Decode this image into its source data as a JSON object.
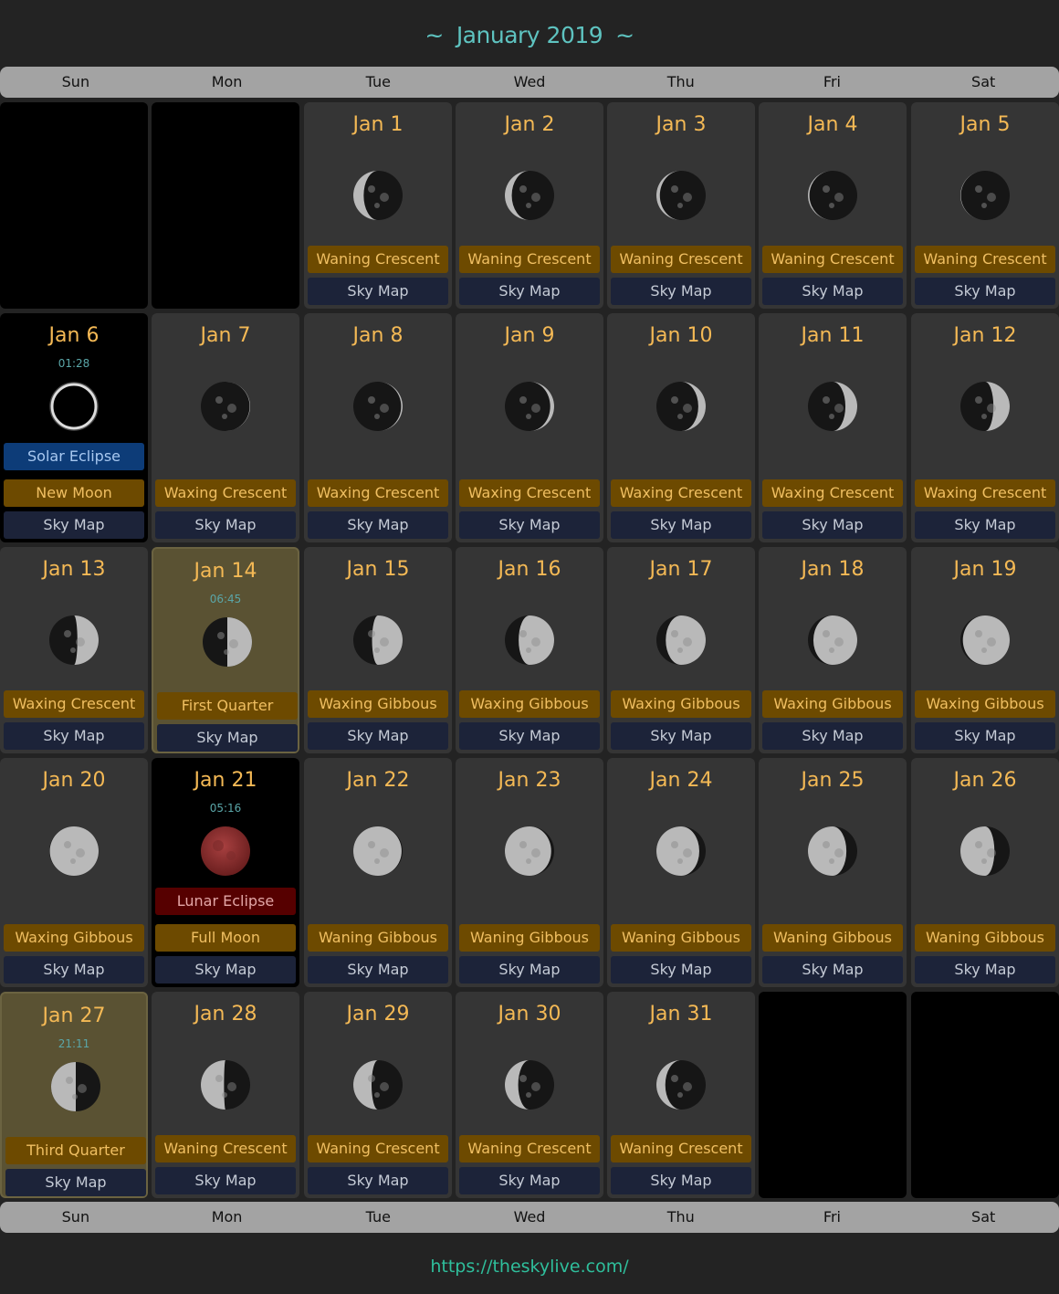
{
  "header": {
    "title": "January 2019",
    "tilde": "~"
  },
  "days_of_week": [
    "Sun",
    "Mon",
    "Tue",
    "Wed",
    "Thu",
    "Fri",
    "Sat"
  ],
  "sky_map_label": "Sky Map",
  "colors": {
    "accent_title": "#5ec3c0",
    "date_text": "#f4b955",
    "phase_badge": "#6d4a00",
    "skymap_badge": "#1c2339",
    "solar_eclipse_badge": "#0d3c78",
    "lunar_eclipse_badge": "#560000",
    "highlight_cell": "#5a5233",
    "footer_link": "#2fbf9c"
  },
  "days": [
    {
      "date": "Jan 1",
      "phase": "Waning Crescent",
      "illum": 0.21,
      "waxing": false
    },
    {
      "date": "Jan 2",
      "phase": "Waning Crescent",
      "illum": 0.14,
      "waxing": false
    },
    {
      "date": "Jan 3",
      "phase": "Waning Crescent",
      "illum": 0.07,
      "waxing": false
    },
    {
      "date": "Jan 4",
      "phase": "Waning Crescent",
      "illum": 0.03,
      "waxing": false
    },
    {
      "date": "Jan 5",
      "phase": "Waning Crescent",
      "illum": 0.01,
      "waxing": false
    },
    {
      "date": "Jan 6",
      "phase": "New Moon",
      "time": "01:28",
      "event": "Solar Eclipse",
      "event_type": "solar",
      "illum": 0,
      "waxing": true
    },
    {
      "date": "Jan 7",
      "phase": "Waxing Crescent",
      "illum": 0.01,
      "waxing": true
    },
    {
      "date": "Jan 8",
      "phase": "Waxing Crescent",
      "illum": 0.03,
      "waxing": true
    },
    {
      "date": "Jan 9",
      "phase": "Waxing Crescent",
      "illum": 0.08,
      "waxing": true
    },
    {
      "date": "Jan 10",
      "phase": "Waxing Crescent",
      "illum": 0.15,
      "waxing": true
    },
    {
      "date": "Jan 11",
      "phase": "Waxing Crescent",
      "illum": 0.24,
      "waxing": true
    },
    {
      "date": "Jan 12",
      "phase": "Waxing Crescent",
      "illum": 0.33,
      "waxing": true
    },
    {
      "date": "Jan 13",
      "phase": "Waxing Crescent",
      "illum": 0.43,
      "waxing": true
    },
    {
      "date": "Jan 14",
      "phase": "First Quarter",
      "time": "06:45",
      "highlight": true,
      "illum": 0.5,
      "waxing": true
    },
    {
      "date": "Jan 15",
      "phase": "Waxing Gibbous",
      "illum": 0.62,
      "waxing": true
    },
    {
      "date": "Jan 16",
      "phase": "Waxing Gibbous",
      "illum": 0.72,
      "waxing": true
    },
    {
      "date": "Jan 17",
      "phase": "Waxing Gibbous",
      "illum": 0.81,
      "waxing": true
    },
    {
      "date": "Jan 18",
      "phase": "Waxing Gibbous",
      "illum": 0.89,
      "waxing": true
    },
    {
      "date": "Jan 19",
      "phase": "Waxing Gibbous",
      "illum": 0.95,
      "waxing": true
    },
    {
      "date": "Jan 20",
      "phase": "Waxing Gibbous",
      "illum": 0.99,
      "waxing": true
    },
    {
      "date": "Jan 21",
      "phase": "Full Moon",
      "time": "05:16",
      "event": "Lunar Eclipse",
      "event_type": "lunar",
      "illum": 1,
      "waxing": false
    },
    {
      "date": "Jan 22",
      "phase": "Waning Gibbous",
      "illum": 0.98,
      "waxing": false
    },
    {
      "date": "Jan 23",
      "phase": "Waning Gibbous",
      "illum": 0.94,
      "waxing": false
    },
    {
      "date": "Jan 24",
      "phase": "Waning Gibbous",
      "illum": 0.87,
      "waxing": false
    },
    {
      "date": "Jan 25",
      "phase": "Waning Gibbous",
      "illum": 0.78,
      "waxing": false
    },
    {
      "date": "Jan 26",
      "phase": "Waning Gibbous",
      "illum": 0.69,
      "waxing": false
    },
    {
      "date": "Jan 27",
      "phase": "Third Quarter",
      "time": "21:11",
      "highlight": true,
      "illum": 0.5,
      "waxing": false
    },
    {
      "date": "Jan 28",
      "phase": "Waning Crescent",
      "illum": 0.47,
      "waxing": false
    },
    {
      "date": "Jan 29",
      "phase": "Waning Crescent",
      "illum": 0.37,
      "waxing": false
    },
    {
      "date": "Jan 30",
      "phase": "Waning Crescent",
      "illum": 0.27,
      "waxing": false
    },
    {
      "date": "Jan 31",
      "phase": "Waning Crescent",
      "illum": 0.18,
      "waxing": false
    }
  ],
  "footer": {
    "link": "https://theskylive.com/"
  }
}
